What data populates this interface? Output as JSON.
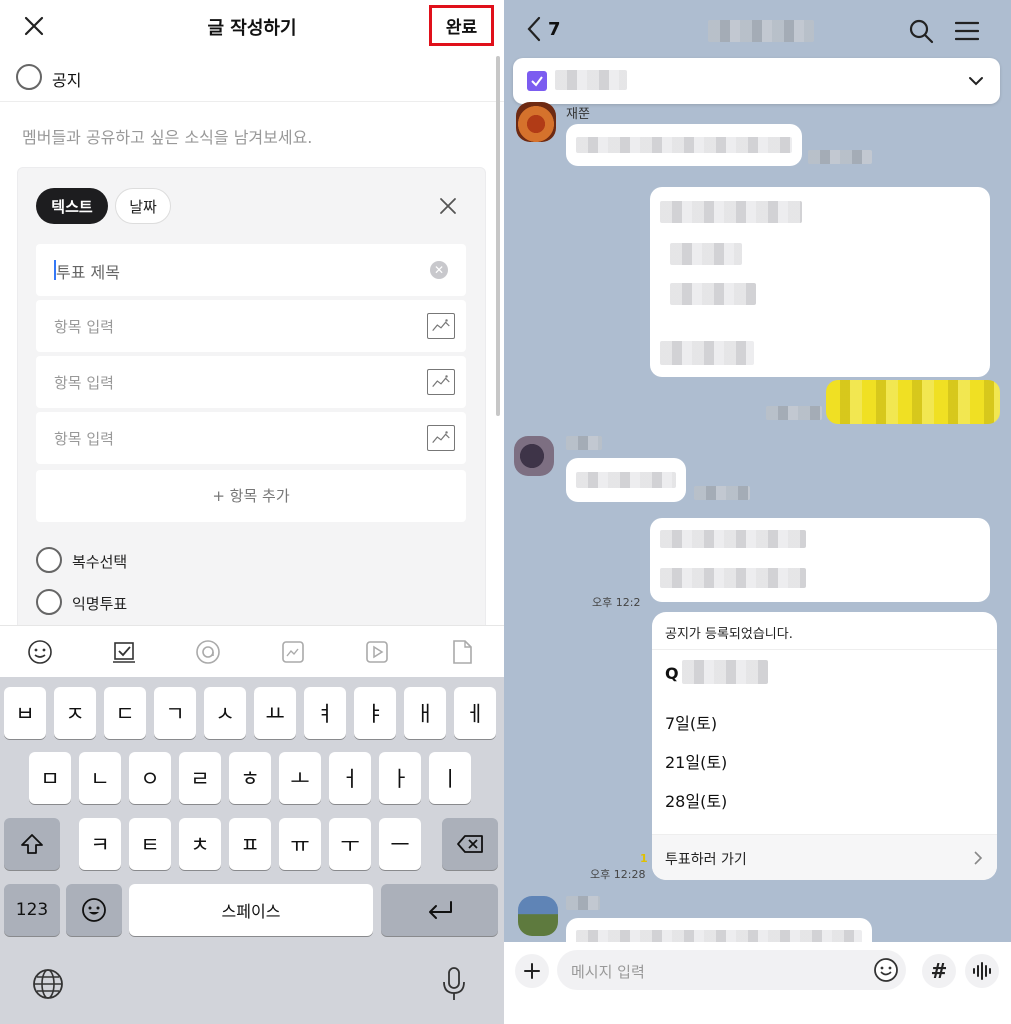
{
  "left": {
    "header": {
      "title": "글 작성하기",
      "done_label": "완료"
    },
    "notice_label": "공지",
    "share_placeholder": "멤버들과 공유하고 싶은 소식을 남겨보세요.",
    "poll": {
      "tab_text": "텍스트",
      "tab_date": "날짜",
      "title_placeholder": "투표 제목",
      "item_placeholders": [
        "항목 입력",
        "항목 입력",
        "항목 입력"
      ],
      "add_item": "+ 항목 추가",
      "options": [
        "복수선택",
        "익명투표"
      ]
    },
    "toolbar_icons": [
      "emoji-icon",
      "vote-icon",
      "mention-icon",
      "photo-icon",
      "video-icon",
      "file-icon"
    ],
    "keyboard": {
      "row1": [
        "ㅂ",
        "ㅈ",
        "ㄷ",
        "ㄱ",
        "ㅅ",
        "ㅛ",
        "ㅕ",
        "ㅑ",
        "ㅐ",
        "ㅔ"
      ],
      "row2": [
        "ㅁ",
        "ㄴ",
        "ㅇ",
        "ㄹ",
        "ㅎ",
        "ㅗ",
        "ㅓ",
        "ㅏ",
        "ㅣ"
      ],
      "row3": [
        "ㅋ",
        "ㅌ",
        "ㅊ",
        "ㅍ",
        "ㅠ",
        "ㅜ",
        "ㅡ"
      ],
      "numbers_key": "123",
      "space_key": "스페이스"
    }
  },
  "right": {
    "header": {
      "member_count": "7"
    },
    "sender_name": "재쭌",
    "time_1": "오후 12:2",
    "time_2": "오후 12:28",
    "unread_count": "1",
    "poll_card": {
      "header": "공지가 등록되었습니다.",
      "question_prefix": "Q",
      "options": [
        "7일(토)",
        "21일(토)",
        "28일(토)"
      ],
      "go_vote": "투표하러 가기"
    },
    "input_placeholder": "메시지 입력",
    "hash_label": "#"
  },
  "colors": {
    "done_border": "#e0101a",
    "chat_background": "#aebdd0",
    "notice_check": "#7b5cf0",
    "highlight_yellow": "#f3e21a"
  }
}
